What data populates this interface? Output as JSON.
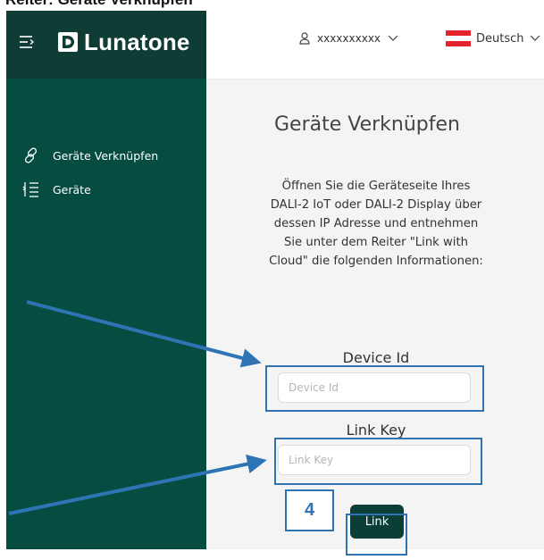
{
  "document": {
    "heading": "Reiter: Geräte Verknüpfen"
  },
  "app": {
    "brand": "Lunatone",
    "user_name": "xxxxxxxxxx",
    "language": "Deutsch"
  },
  "sidebar": {
    "items": [
      {
        "label": "Geräte Verknüpfen",
        "icon": "link-icon"
      },
      {
        "label": "Geräte",
        "icon": "device-list-icon"
      }
    ]
  },
  "main": {
    "title": "Geräte Verknüpfen",
    "info_text": "Öffnen Sie die Geräteseite Ihres DALI-2 IoT oder DALI-2 Display über dessen IP Adresse und entnehmen Sie unter dem Reiter \"Link with Cloud\" die folgenden Informationen:",
    "device_id": {
      "label": "Device Id",
      "placeholder": "Device Id",
      "value": ""
    },
    "link_key": {
      "label": "Link Key",
      "placeholder": "Link Key",
      "value": ""
    },
    "link_button": "Link"
  },
  "annotation": {
    "step_number": "4"
  },
  "colors": {
    "sidebar_bg": "#064c41",
    "header_dark": "#0f3c35",
    "content_bg": "#f4f4f4",
    "button_bg": "#0b3e36",
    "annotation_blue": "#2e74b5"
  }
}
